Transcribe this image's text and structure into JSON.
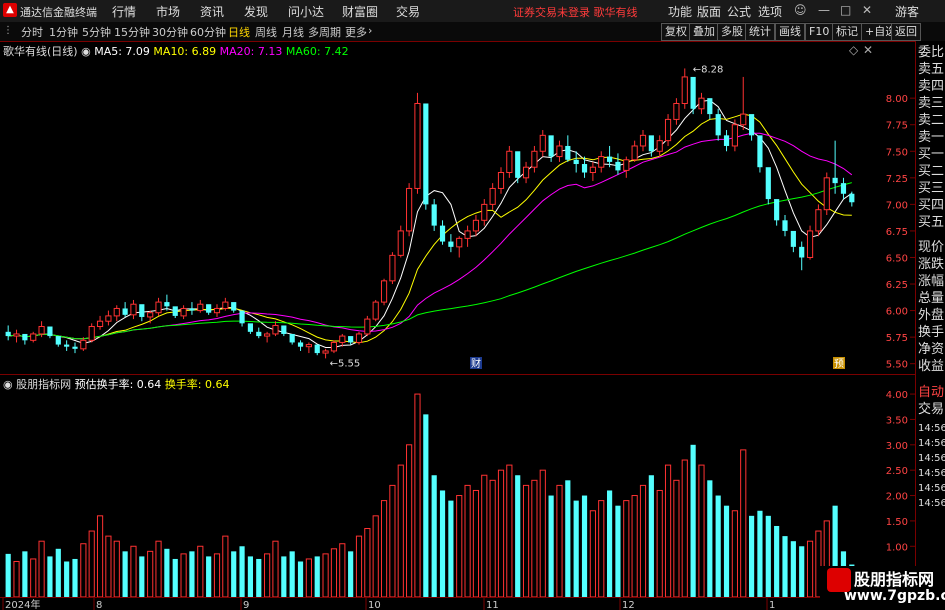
{
  "titlebar": {
    "app_title": "通达信金融终端",
    "menu": [
      "行情",
      "市场",
      "资讯",
      "发现",
      "问小达",
      "财富圈",
      "交易"
    ],
    "warning": "证券交易未登录  歌华有线",
    "right_menu": [
      "功能",
      "版面",
      "公式",
      "选项"
    ],
    "guest": "游客"
  },
  "periodbar": {
    "periods": [
      "分时",
      "1分钟",
      "5分钟",
      "15分钟",
      "30分钟",
      "60分钟",
      "日线",
      "周线",
      "月线",
      "多周期",
      "更多"
    ],
    "active": "日线",
    "buttons": [
      "复权",
      "叠加",
      "多股",
      "统计",
      "画线",
      "F10",
      "标记",
      "+自选",
      "返回"
    ]
  },
  "main_legend": {
    "name": "歌华有线(日线)",
    "ma5": "MA5: 7.09",
    "ma10": "MA10: 6.89",
    "ma20": "MA20: 7.13",
    "ma60": "MA60: 7.42"
  },
  "sub_legend": {
    "name": "股朋指标网",
    "est_turnover": "预估换手率: 0.64",
    "turnover": "换手率: 0.64"
  },
  "annotations": {
    "high": "8.28",
    "low": "5.55",
    "fin": "财",
    "pre": "预"
  },
  "right_panel": [
    "委比",
    "卖五",
    "卖四",
    "卖三",
    "卖二",
    "卖一",
    "买一",
    "买二",
    "买三",
    "买四",
    "买五",
    "现价",
    "涨跌",
    "涨幅",
    "总量",
    "外盘",
    "换手",
    "净资",
    "收益",
    "自动",
    "交易",
    "14:56",
    "14:56",
    "14:56",
    "14:56",
    "14:56",
    "14:56"
  ],
  "price_axis": [
    "8.00",
    "7.75",
    "7.50",
    "7.25",
    "7.00",
    "6.75",
    "6.50",
    "6.25",
    "6.00",
    "5.75",
    "5.50"
  ],
  "vol_axis": [
    "4.00",
    "3.50",
    "3.00",
    "2.50",
    "2.00",
    "1.50",
    "1.00"
  ],
  "time_axis": [
    "2024年",
    "8",
    "9",
    "10",
    "11",
    "12",
    "1"
  ],
  "watermark": {
    "line1": "股朋指标网",
    "line2": "www.7gpzb.com"
  },
  "colors": {
    "up": "#ff3232",
    "down": "#54ffff",
    "ma5": "#ffffff",
    "ma10": "#ffff00",
    "ma20": "#ff00ff",
    "ma60": "#00ff00"
  },
  "chart_data": {
    "type": "candlestick",
    "price_range": [
      5.45,
      8.35
    ],
    "volume_range": [
      0,
      4.1
    ],
    "candles": [
      [
        5.8,
        5.86,
        5.72,
        5.76
      ],
      [
        5.76,
        5.82,
        5.7,
        5.78
      ],
      [
        5.78,
        5.75,
        5.68,
        5.72
      ],
      [
        5.72,
        5.8,
        5.7,
        5.78
      ],
      [
        5.78,
        5.9,
        5.75,
        5.85
      ],
      [
        5.85,
        5.83,
        5.74,
        5.76
      ],
      [
        5.76,
        5.74,
        5.66,
        5.68
      ],
      [
        5.68,
        5.72,
        5.62,
        5.66
      ],
      [
        5.66,
        5.7,
        5.6,
        5.64
      ],
      [
        5.64,
        5.75,
        5.62,
        5.72
      ],
      [
        5.72,
        5.88,
        5.7,
        5.85
      ],
      [
        5.85,
        5.95,
        5.82,
        5.9
      ],
      [
        5.9,
        6.0,
        5.86,
        5.95
      ],
      [
        5.95,
        6.05,
        5.9,
        6.02
      ],
      [
        6.02,
        6.08,
        5.94,
        5.96
      ],
      [
        5.96,
        6.1,
        5.92,
        6.06
      ],
      [
        6.06,
        6.02,
        5.9,
        5.94
      ],
      [
        5.94,
        6.0,
        5.88,
        5.98
      ],
      [
        5.98,
        6.12,
        5.95,
        6.08
      ],
      [
        6.08,
        6.15,
        6.0,
        6.04
      ],
      [
        6.04,
        6.02,
        5.93,
        5.95
      ],
      [
        5.95,
        6.05,
        5.92,
        6.02
      ],
      [
        6.02,
        6.08,
        5.96,
        6.0
      ],
      [
        6.0,
        6.1,
        5.98,
        6.06
      ],
      [
        6.06,
        6.04,
        5.96,
        5.98
      ],
      [
        5.98,
        6.06,
        5.94,
        6.02
      ],
      [
        6.02,
        6.12,
        6.0,
        6.08
      ],
      [
        6.08,
        6.06,
        5.98,
        6.0
      ],
      [
        6.0,
        5.98,
        5.85,
        5.88
      ],
      [
        5.88,
        5.86,
        5.78,
        5.8
      ],
      [
        5.8,
        5.84,
        5.74,
        5.76
      ],
      [
        5.76,
        5.8,
        5.7,
        5.78
      ],
      [
        5.78,
        5.9,
        5.76,
        5.86
      ],
      [
        5.86,
        5.84,
        5.76,
        5.78
      ],
      [
        5.78,
        5.76,
        5.68,
        5.7
      ],
      [
        5.7,
        5.72,
        5.62,
        5.66
      ],
      [
        5.66,
        5.7,
        5.6,
        5.68
      ],
      [
        5.68,
        5.66,
        5.58,
        5.6
      ],
      [
        5.6,
        5.64,
        5.55,
        5.62
      ],
      [
        5.62,
        5.72,
        5.6,
        5.7
      ],
      [
        5.7,
        5.78,
        5.66,
        5.76
      ],
      [
        5.76,
        5.74,
        5.68,
        5.7
      ],
      [
        5.7,
        5.8,
        5.68,
        5.78
      ],
      [
        5.78,
        5.95,
        5.76,
        5.92
      ],
      [
        5.92,
        6.1,
        5.9,
        6.08
      ],
      [
        6.08,
        6.3,
        6.05,
        6.28
      ],
      [
        6.28,
        6.55,
        6.25,
        6.52
      ],
      [
        6.52,
        6.8,
        6.5,
        6.75
      ],
      [
        6.75,
        7.2,
        6.7,
        7.15
      ],
      [
        7.15,
        8.05,
        7.1,
        7.95
      ],
      [
        7.95,
        7.3,
        6.95,
        7.0
      ],
      [
        7.0,
        7.05,
        6.75,
        6.8
      ],
      [
        6.8,
        6.85,
        6.62,
        6.65
      ],
      [
        6.65,
        6.72,
        6.55,
        6.6
      ],
      [
        6.6,
        6.7,
        6.5,
        6.68
      ],
      [
        6.68,
        6.8,
        6.6,
        6.75
      ],
      [
        6.75,
        6.9,
        6.7,
        6.85
      ],
      [
        6.85,
        7.05,
        6.8,
        7.0
      ],
      [
        7.0,
        7.2,
        6.95,
        7.15
      ],
      [
        7.15,
        7.35,
        7.1,
        7.3
      ],
      [
        7.3,
        7.55,
        7.25,
        7.5
      ],
      [
        7.5,
        7.45,
        7.2,
        7.25
      ],
      [
        7.25,
        7.4,
        7.2,
        7.35
      ],
      [
        7.35,
        7.55,
        7.3,
        7.5
      ],
      [
        7.5,
        7.7,
        7.45,
        7.65
      ],
      [
        7.65,
        7.6,
        7.4,
        7.45
      ],
      [
        7.45,
        7.6,
        7.4,
        7.55
      ],
      [
        7.55,
        7.65,
        7.4,
        7.42
      ],
      [
        7.42,
        7.5,
        7.3,
        7.38
      ],
      [
        7.38,
        7.45,
        7.25,
        7.3
      ],
      [
        7.3,
        7.4,
        7.22,
        7.35
      ],
      [
        7.35,
        7.5,
        7.3,
        7.45
      ],
      [
        7.45,
        7.55,
        7.35,
        7.4
      ],
      [
        7.4,
        7.48,
        7.28,
        7.32
      ],
      [
        7.32,
        7.45,
        7.25,
        7.42
      ],
      [
        7.42,
        7.6,
        7.4,
        7.55
      ],
      [
        7.55,
        7.7,
        7.5,
        7.65
      ],
      [
        7.65,
        7.6,
        7.45,
        7.5
      ],
      [
        7.5,
        7.65,
        7.45,
        7.6
      ],
      [
        7.6,
        7.85,
        7.55,
        7.8
      ],
      [
        7.8,
        8.0,
        7.75,
        7.95
      ],
      [
        7.95,
        8.28,
        7.9,
        8.2
      ],
      [
        8.2,
        8.1,
        7.85,
        7.9
      ],
      [
        7.9,
        8.05,
        7.85,
        8.0
      ],
      [
        8.0,
        7.95,
        7.8,
        7.85
      ],
      [
        7.85,
        7.9,
        7.6,
        7.65
      ],
      [
        7.65,
        7.7,
        7.5,
        7.55
      ],
      [
        7.55,
        7.8,
        7.5,
        7.75
      ],
      [
        7.75,
        8.2,
        7.7,
        7.85
      ],
      [
        7.85,
        7.8,
        7.6,
        7.65
      ],
      [
        7.65,
        7.55,
        7.3,
        7.35
      ],
      [
        7.35,
        7.3,
        7.0,
        7.05
      ],
      [
        7.05,
        7.0,
        6.8,
        6.85
      ],
      [
        6.85,
        6.9,
        6.7,
        6.75
      ],
      [
        6.75,
        6.7,
        6.55,
        6.6
      ],
      [
        6.6,
        6.65,
        6.38,
        6.5
      ],
      [
        6.5,
        6.8,
        6.48,
        6.75
      ],
      [
        6.75,
        7.0,
        6.7,
        6.95
      ],
      [
        6.95,
        7.3,
        6.9,
        7.25
      ],
      [
        7.25,
        7.6,
        7.1,
        7.2
      ],
      [
        7.2,
        7.25,
        7.05,
        7.1
      ],
      [
        7.1,
        7.12,
        6.98,
        7.02
      ]
    ],
    "volume": [
      0.85,
      0.7,
      0.9,
      0.75,
      1.1,
      0.8,
      0.95,
      0.7,
      0.75,
      1.05,
      1.3,
      1.6,
      1.2,
      1.1,
      0.9,
      1.0,
      0.8,
      0.9,
      1.1,
      0.95,
      0.75,
      0.85,
      0.9,
      1.0,
      0.8,
      0.85,
      1.2,
      0.9,
      1.0,
      0.8,
      0.75,
      0.85,
      1.1,
      0.8,
      0.9,
      0.7,
      0.75,
      0.8,
      0.85,
      0.95,
      1.05,
      0.9,
      1.2,
      1.35,
      1.6,
      1.9,
      2.2,
      2.6,
      3.0,
      4.0,
      3.6,
      2.4,
      2.1,
      1.9,
      2.0,
      2.2,
      2.1,
      2.4,
      2.3,
      2.5,
      2.6,
      2.4,
      2.2,
      2.3,
      2.5,
      2.0,
      2.2,
      2.3,
      1.9,
      2.0,
      1.7,
      1.9,
      2.1,
      1.8,
      1.9,
      2.0,
      2.2,
      2.4,
      2.1,
      2.6,
      2.3,
      2.7,
      3.0,
      2.6,
      2.3,
      2.0,
      1.8,
      1.7,
      2.9,
      1.6,
      1.7,
      1.6,
      1.4,
      1.2,
      1.1,
      1.0,
      1.1,
      1.3,
      1.5,
      1.8,
      0.9,
      0.64
    ]
  }
}
